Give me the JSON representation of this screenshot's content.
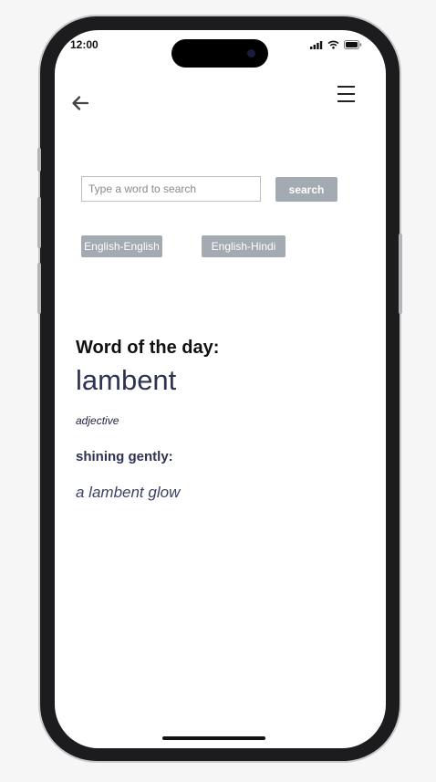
{
  "status_bar": {
    "time": "12:00",
    "icons": [
      "signal-icon",
      "wifi-icon",
      "battery-icon"
    ]
  },
  "header": {
    "back_icon": "arrow-left-icon",
    "menu_icon": "hamburger-menu-icon"
  },
  "search": {
    "placeholder": "Type a word to search",
    "value": "",
    "button_label": "search"
  },
  "dictionaries": [
    {
      "label": "English-English"
    },
    {
      "label": "English-Hindi"
    }
  ],
  "word_of_the_day": {
    "heading": "Word of the day:",
    "word": "lambent",
    "part_of_speech": "adjective",
    "meaning": "shining gently:",
    "example": "a lambent glow"
  },
  "colors": {
    "button_bg": "#a3aab1",
    "word_color": "#2e3352",
    "frame": "#1c1c1e"
  }
}
